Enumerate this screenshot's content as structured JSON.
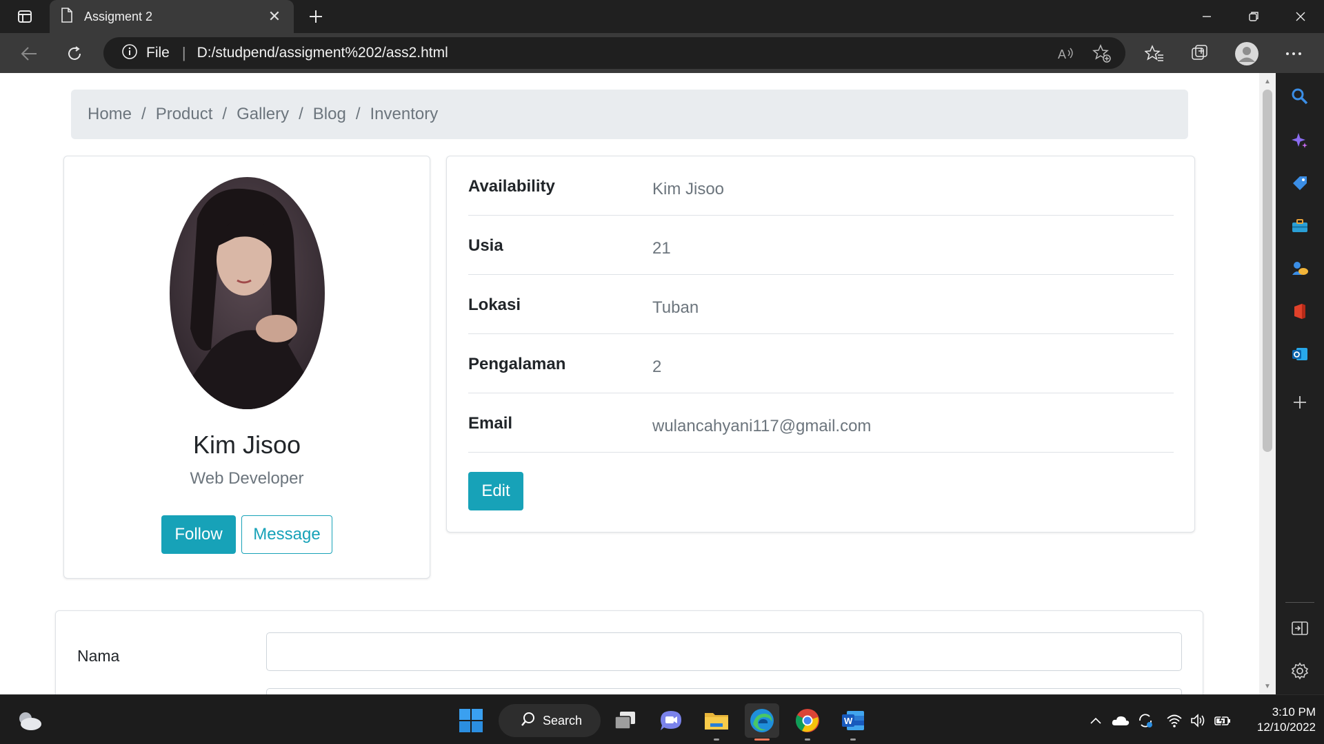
{
  "browser": {
    "tab_title": "Assigment 2",
    "protocol_label": "File",
    "url": "D:/studpend/assigment%202/ass2.html"
  },
  "page": {
    "breadcrumb": [
      "Home",
      "Product",
      "Gallery",
      "Blog",
      "Inventory"
    ],
    "profile": {
      "name": "Kim Jisoo",
      "role": "Web Developer",
      "follow_label": "Follow",
      "message_label": "Message"
    },
    "info": {
      "rows": [
        {
          "label": "Availability",
          "value": "Kim Jisoo"
        },
        {
          "label": "Usia",
          "value": "21"
        },
        {
          "label": "Lokasi",
          "value": "Tuban"
        },
        {
          "label": "Pengalaman",
          "value": "2"
        },
        {
          "label": "Email",
          "value": "wulancahyani117@gmail.com"
        }
      ],
      "edit_label": "Edit"
    },
    "form": {
      "nama_label": "Nama"
    }
  },
  "taskbar": {
    "search_label": "Search",
    "time": "3:10 PM",
    "date": "12/10/2022"
  },
  "colors": {
    "accent": "#17a2b8",
    "breadcrumb_bg": "#e9ecef",
    "muted_text": "#6c757d"
  }
}
